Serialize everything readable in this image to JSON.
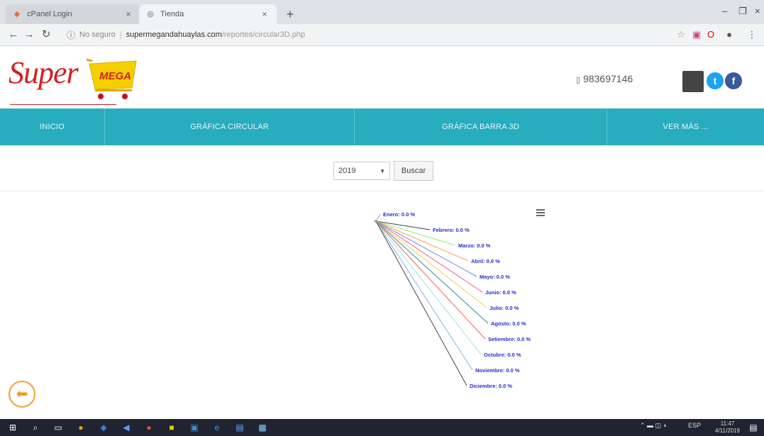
{
  "browser": {
    "tabs": [
      {
        "title": "cPanel Login"
      },
      {
        "title": "Tienda"
      }
    ],
    "address": {
      "security": "No seguro",
      "domain": "supermegandahuaylas.com",
      "path": "/reportes/circular3D.php"
    }
  },
  "header": {
    "logo_text": "Super",
    "logo_badge": "MEGA",
    "phone": "983697146"
  },
  "nav": {
    "items": [
      "INICIO",
      "GRÁFICA CIRCULAR",
      "GRÁFICA BARRA 3D",
      "VER MÁS ..."
    ]
  },
  "filter": {
    "year": "2019",
    "search_label": "Buscar"
  },
  "chart_data": {
    "type": "pie",
    "title": "",
    "labels": [
      "Enero: 0.0 %",
      "Febrero: 0.0 %",
      "Marzo: 0.0 %",
      "Abril: 0.0 %",
      "Mayo: 0.0 %",
      "Junio: 0.0 %",
      "Julio: 0.0 %",
      "Agosto: 0.0 %",
      "Setiembre: 0.0 %",
      "Octubre: 0.0 %",
      "Noviembre: 0.0 %",
      "Diciembre: 0.0 %"
    ],
    "categories": [
      "Enero",
      "Febrero",
      "Marzo",
      "Abril",
      "Mayo",
      "Junio",
      "Julio",
      "Agosto",
      "Setiembre",
      "Octubre",
      "Noviembre",
      "Diciembre"
    ],
    "values": [
      0,
      0,
      0,
      0,
      0,
      0,
      0,
      0,
      0,
      0,
      0,
      0
    ],
    "colors": [
      "#7cb5ec",
      "#434348",
      "#90ed7d",
      "#f7a35c",
      "#8085e9",
      "#f15c80",
      "#e4d354",
      "#2b908f",
      "#f45b5b",
      "#91e8e1",
      "#7cb5ec",
      "#434348"
    ]
  },
  "taskbar": {
    "lang": "ESP",
    "time": "11:47",
    "date": "4/11/2019"
  }
}
